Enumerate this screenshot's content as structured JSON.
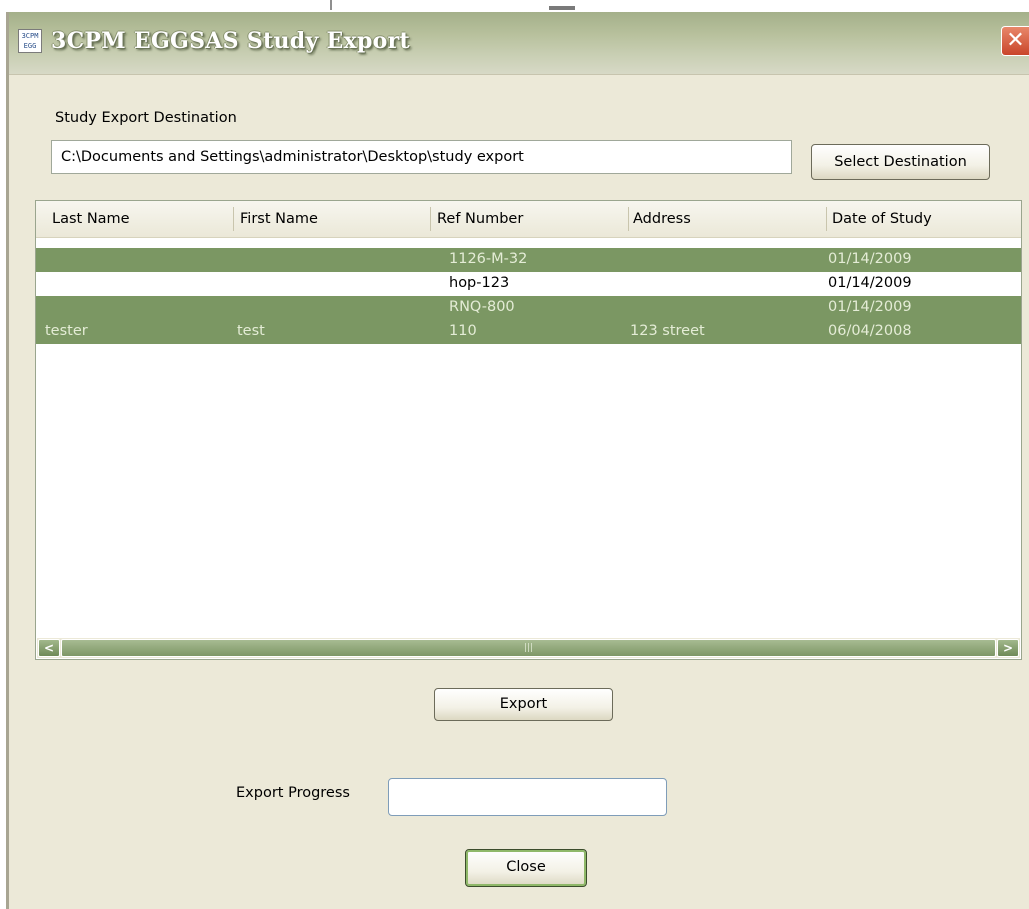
{
  "window": {
    "title": "3CPM EGGSAS Study Export",
    "icon_text": "3CPM EGG",
    "close_glyph": "✕"
  },
  "destination": {
    "label": "Study Export Destination",
    "path": "C:\\Documents and Settings\\administrator\\Desktop\\study export",
    "select_button": "Select Destination"
  },
  "table": {
    "columns": [
      "Last Name",
      "First Name",
      "Ref Number",
      "Address",
      "Date of Study"
    ],
    "rows": [
      {
        "last": "",
        "first": "",
        "ref": "1126-M-32",
        "address": "",
        "date": "01/14/2009",
        "selected": true
      },
      {
        "last": "",
        "first": "",
        "ref": "hop-123",
        "address": "",
        "date": "01/14/2009",
        "selected": false
      },
      {
        "last": "",
        "first": "",
        "ref": "RNQ-800",
        "address": "",
        "date": "01/14/2009",
        "selected": true
      },
      {
        "last": "tester",
        "first": "test",
        "ref": "110",
        "address": "123 street",
        "date": "06/04/2008",
        "selected": true
      }
    ]
  },
  "scrollbar": {
    "left_arrow": "<",
    "right_arrow": ">",
    "grip": "|||"
  },
  "actions": {
    "export_button": "Export",
    "progress_label": "Export Progress",
    "progress_value": 0,
    "close_button": "Close"
  },
  "colors": {
    "selection": "#7b9763",
    "window_bg": "#ece9d8"
  }
}
